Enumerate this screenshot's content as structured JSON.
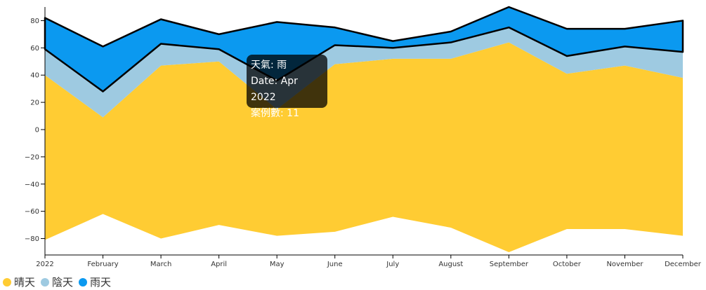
{
  "chart_data": {
    "type": "area",
    "subtype": "streamgraph",
    "categories": [
      "2022",
      "February",
      "March",
      "April",
      "May",
      "June",
      "July",
      "August",
      "September",
      "October",
      "November",
      "December"
    ],
    "series": [
      {
        "name": "晴天",
        "color": "#ffcc33",
        "values": [
          121,
          71,
          127,
          120,
          93,
          123,
          116,
          124,
          154,
          114,
          120,
          116
        ]
      },
      {
        "name": "陰天",
        "color": "#9ecae1",
        "values": [
          19,
          19,
          16,
          9,
          21,
          14,
          8,
          12,
          11,
          13,
          14,
          19
        ]
      },
      {
        "name": "雨天",
        "color": "#0b99f0",
        "values": [
          23,
          33,
          18,
          11,
          43,
          13,
          5,
          8,
          15,
          20,
          13,
          23
        ]
      }
    ],
    "highlight_series": "雨天",
    "baseline_values": [
      -81,
      -62,
      -80,
      -70,
      -78,
      -75,
      -64,
      -72,
      -90,
      -73,
      -73,
      -78
    ],
    "ylim": [
      -90,
      90
    ],
    "yticks": [
      -80,
      -60,
      -40,
      -20,
      0,
      20,
      40,
      60,
      80
    ],
    "xlabel": "",
    "ylabel": "",
    "legend_position": "bottom-left",
    "tooltip": {
      "line1": "天氣: 雨",
      "line2": "Date: Apr 2022",
      "line3": "案例數: 11"
    }
  }
}
